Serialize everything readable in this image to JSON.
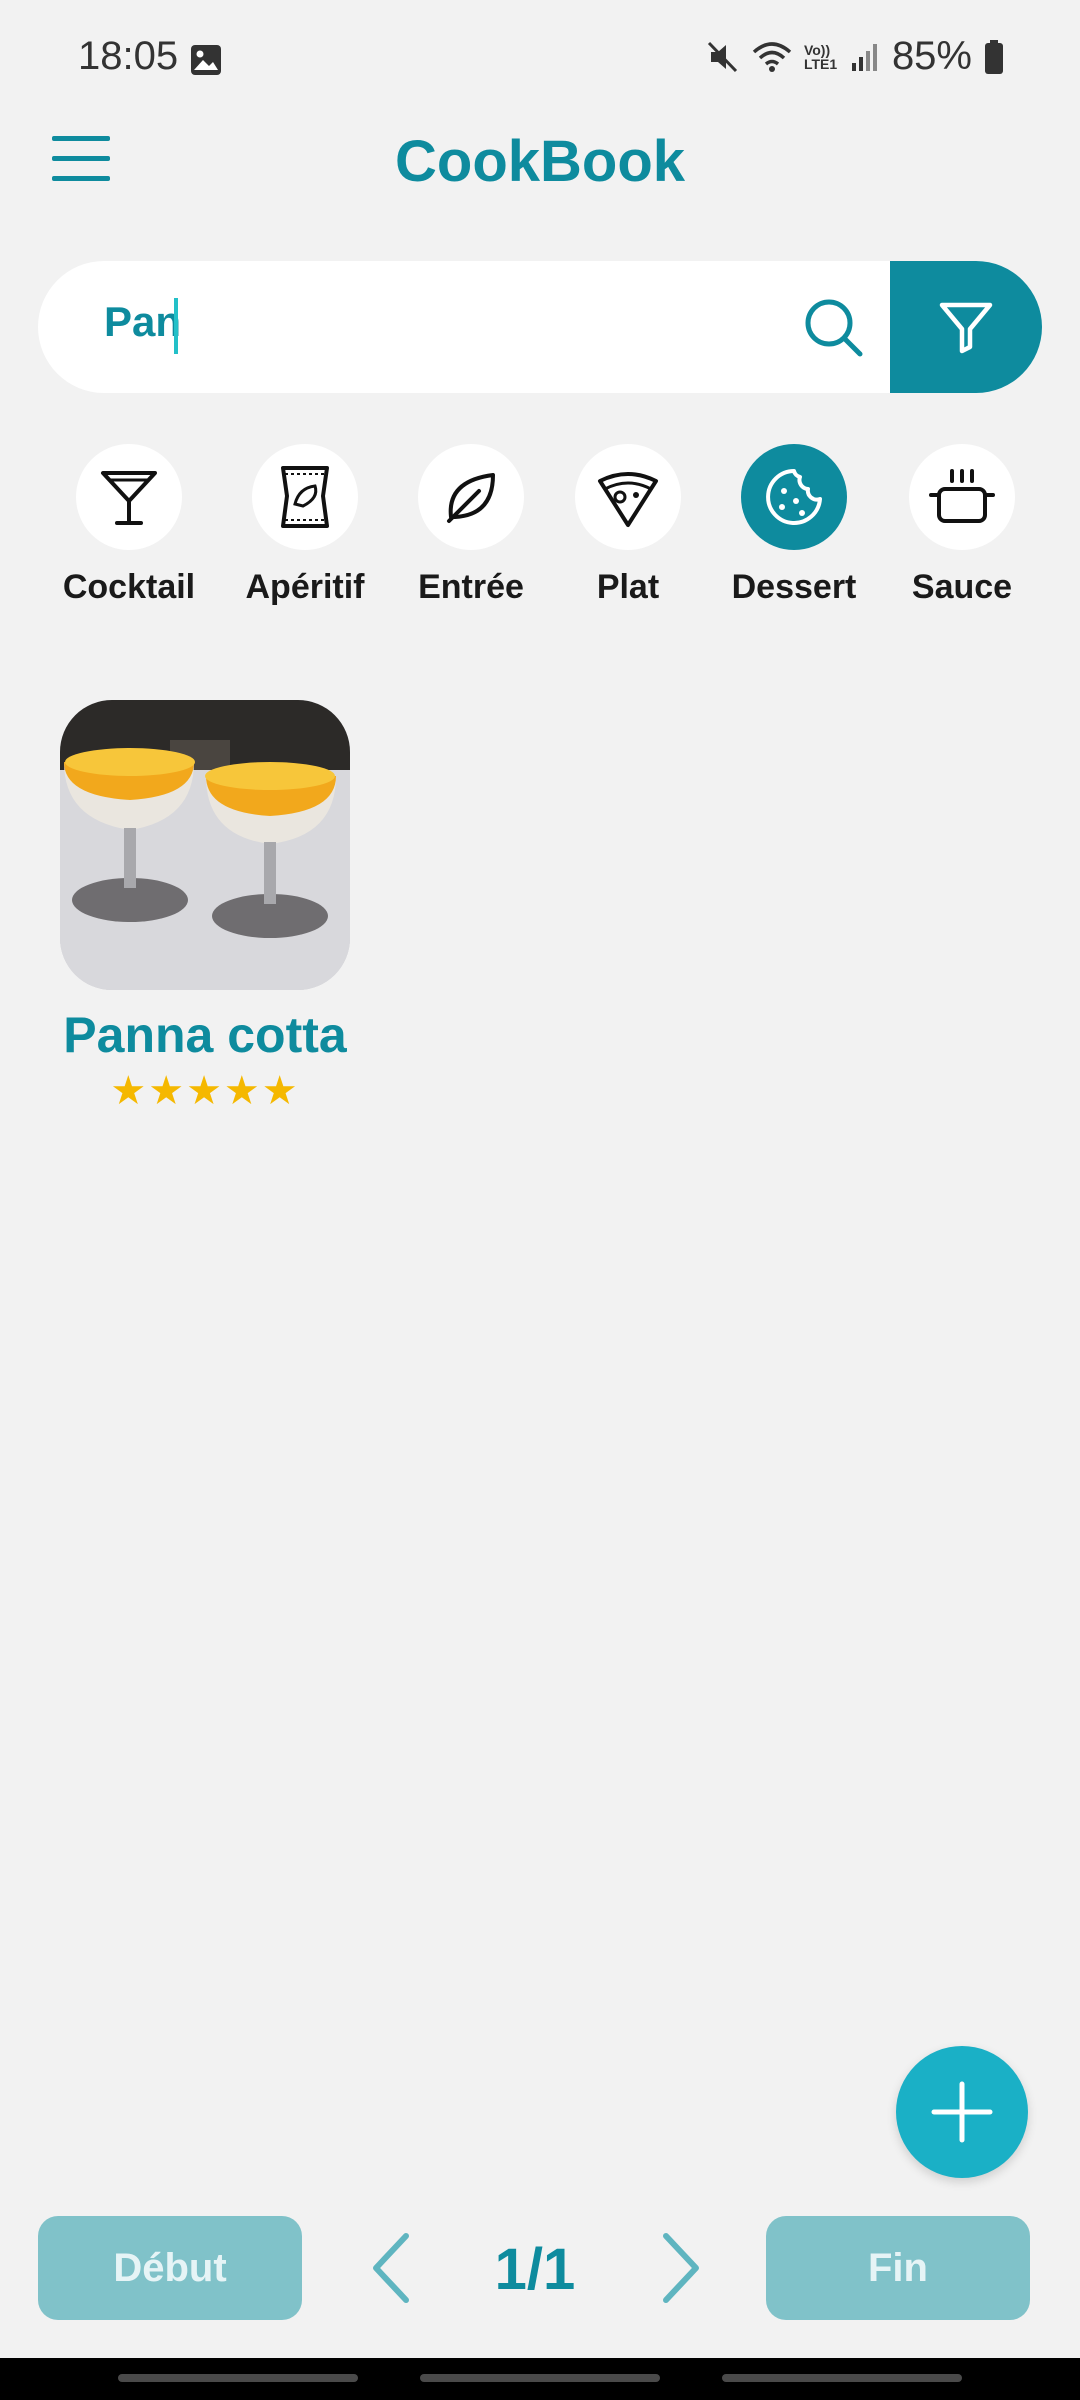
{
  "status_bar": {
    "time": "18:05",
    "battery": "85%",
    "network_label": "Vo)) LTE1"
  },
  "header": {
    "title": "CookBook"
  },
  "search": {
    "value": "Pan"
  },
  "categories": [
    {
      "label": "Cocktail",
      "icon": "cocktail-glass-icon",
      "selected": false
    },
    {
      "label": "Apéritif",
      "icon": "chips-bag-icon",
      "selected": false
    },
    {
      "label": "Entrée",
      "icon": "leaf-icon",
      "selected": false
    },
    {
      "label": "Plat",
      "icon": "pizza-slice-icon",
      "selected": false
    },
    {
      "label": "Dessert",
      "icon": "cookie-icon",
      "selected": true
    },
    {
      "label": "Sauce",
      "icon": "cooking-pot-icon",
      "selected": false
    }
  ],
  "recipes": [
    {
      "title": "Panna cotta",
      "rating": 5,
      "rating_max": 5,
      "stars": "★★★★★"
    }
  ],
  "pagination": {
    "first_label": "Début",
    "last_label": "Fin",
    "page_indicator": "1/1"
  },
  "colors": {
    "accent": "#0e8b9e",
    "fab": "#1ab0c6",
    "disabled_button": "#80c2c9",
    "star": "#f5b800",
    "background": "#f2f2f2"
  }
}
